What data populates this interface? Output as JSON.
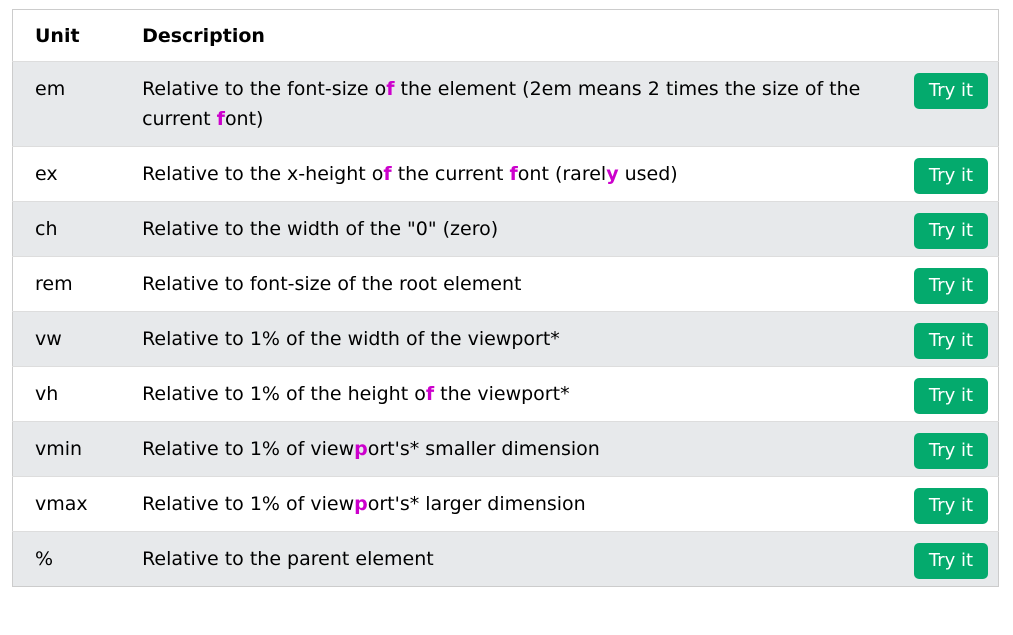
{
  "table": {
    "headers": {
      "unit": "Unit",
      "description": "Description"
    },
    "rows": [
      {
        "unit": "em",
        "desc_parts": [
          "Relative to the font-size o",
          "f",
          " the element (2em means 2 times the size of the current ",
          "f",
          "ont)"
        ],
        "button": "Try it"
      },
      {
        "unit": "ex",
        "desc_parts": [
          "Relative to the x-height o",
          "f",
          " the current ",
          "f",
          "ont (rarel",
          "y",
          " used)"
        ],
        "button": "Try it"
      },
      {
        "unit": "ch",
        "desc_parts": [
          "Relative to the width of the \"0\" (zero)"
        ],
        "button": "Try it"
      },
      {
        "unit": "rem",
        "desc_parts": [
          "Relative to font-size of the root element"
        ],
        "button": "Try it"
      },
      {
        "unit": "vw",
        "desc_parts": [
          "Relative to 1% of the width of the viewport*"
        ],
        "button": "Try it"
      },
      {
        "unit": "vh",
        "desc_parts": [
          "Relative to 1% of the height o",
          "f",
          " the viewport*"
        ],
        "button": "Try it"
      },
      {
        "unit": "vmin",
        "desc_parts": [
          "Relative to 1% of view",
          "p",
          "ort's* smaller dimension"
        ],
        "button": "Try it"
      },
      {
        "unit": "vmax",
        "desc_parts": [
          "Relative to 1% of view",
          "p",
          "ort's* larger dimension"
        ],
        "button": "Try it"
      },
      {
        "unit": "%",
        "desc_parts": [
          "Relative to the parent element"
        ],
        "button": "Try it"
      }
    ]
  },
  "colors": {
    "button_bg": "#04aa6d",
    "highlight": "#cc00cc",
    "row_alt": "#e7e9eb"
  }
}
